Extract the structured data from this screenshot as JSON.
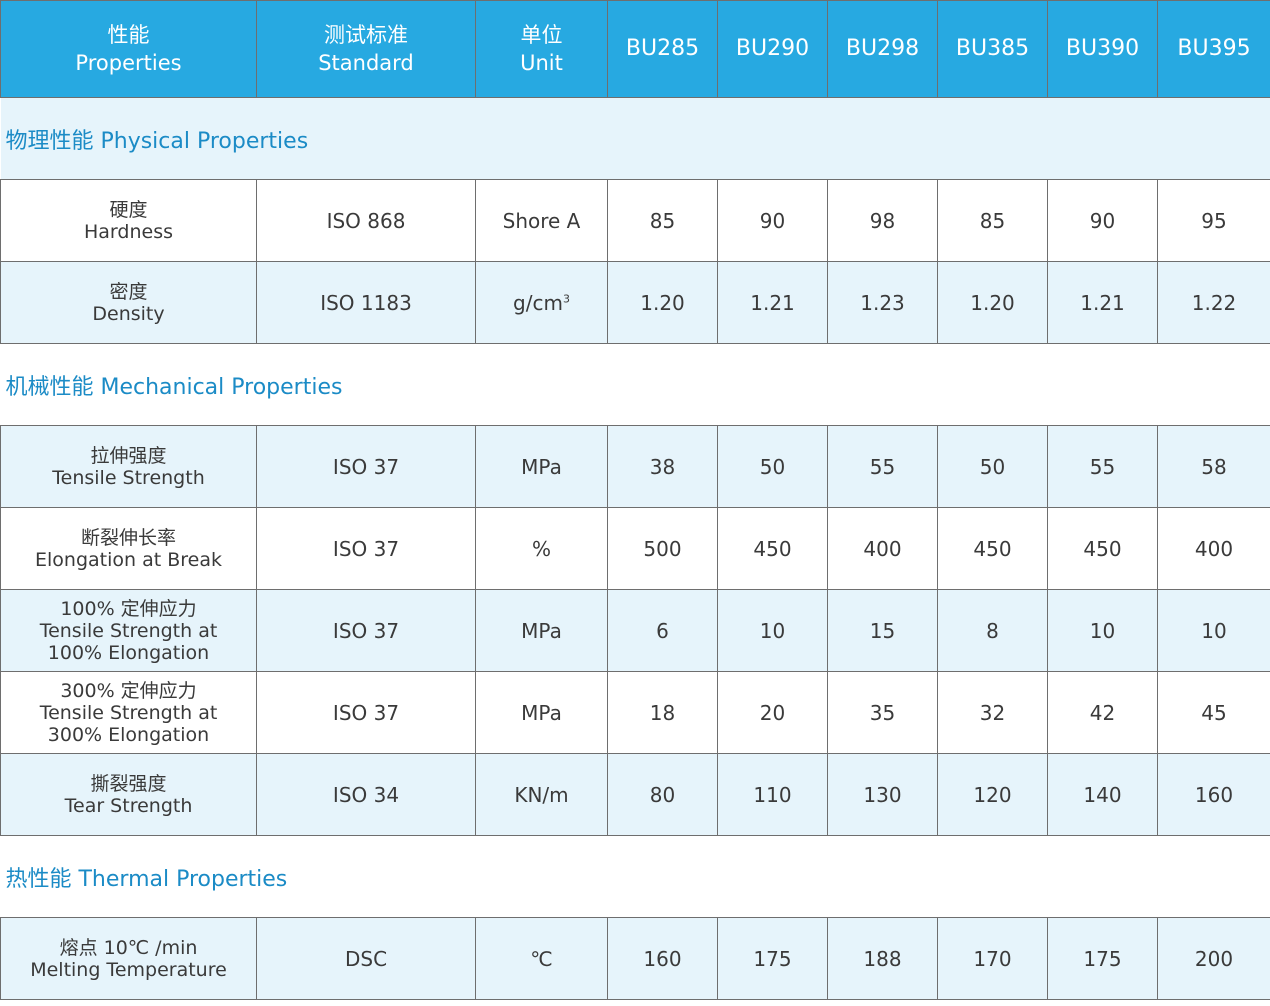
{
  "header": {
    "properties": {
      "zh": "性能",
      "en": "Properties"
    },
    "standard": {
      "zh": "测试标准",
      "en": "Standard"
    },
    "unit": {
      "zh": "单位",
      "en": "Unit"
    },
    "models": [
      "BU285",
      "BU290",
      "BU298",
      "BU385",
      "BU390",
      "BU395"
    ]
  },
  "colors": {
    "header_bg": "#27a9e1",
    "section_text": "#1b8bc6",
    "row_tint": "#e6f4fb",
    "border": "#6e6e6e"
  },
  "sections": [
    {
      "title": "物理性能 Physical Properties",
      "rows": [
        {
          "zh": "硬度",
          "en": "Hardness",
          "standard": "ISO 868",
          "unit": "Shore A",
          "values": [
            "85",
            "90",
            "98",
            "85",
            "90",
            "95"
          ]
        },
        {
          "zh": "密度",
          "en": "Density",
          "standard": "ISO 1183",
          "unit": "g/cm",
          "unit_sup": "3",
          "values": [
            "1.20",
            "1.21",
            "1.23",
            "1.20",
            "1.21",
            "1.22"
          ]
        }
      ]
    },
    {
      "title": "机械性能   Mechanical Properties",
      "rows": [
        {
          "zh": "拉伸强度",
          "en": "Tensile Strength",
          "standard": "ISO 37",
          "unit": "MPa",
          "values": [
            "38",
            "50",
            "55",
            "50",
            "55",
            "58"
          ]
        },
        {
          "zh": "断裂伸长率",
          "en": "Elongation at Break",
          "standard": "ISO 37",
          "unit": "%",
          "values": [
            "500",
            "450",
            "400",
            "450",
            "450",
            "400"
          ]
        },
        {
          "zh": "100% 定伸应力",
          "en": "Tensile Strength at",
          "en2": "100% Elongation",
          "standard": "ISO 37",
          "unit": "MPa",
          "values": [
            "6",
            "10",
            "15",
            "8",
            "10",
            "10"
          ]
        },
        {
          "zh": "300% 定伸应力",
          "en": "Tensile Strength at",
          "en2": "300% Elongation",
          "standard": "ISO 37",
          "unit": "MPa",
          "values": [
            "18",
            "20",
            "35",
            "32",
            "42",
            "45"
          ]
        },
        {
          "zh": "撕裂强度",
          "en": "Tear Strength",
          "standard": "ISO 34",
          "unit": "KN/m",
          "values": [
            "80",
            "110",
            "130",
            "120",
            "140",
            "160"
          ]
        }
      ]
    },
    {
      "title": "热性能   Thermal Properties",
      "rows": [
        {
          "zh": "熔点 10℃ /min",
          "en": "Melting Temperature",
          "standard": "DSC",
          "unit": "℃",
          "values": [
            "160",
            "175",
            "188",
            "170",
            "175",
            "200"
          ]
        }
      ]
    }
  ]
}
